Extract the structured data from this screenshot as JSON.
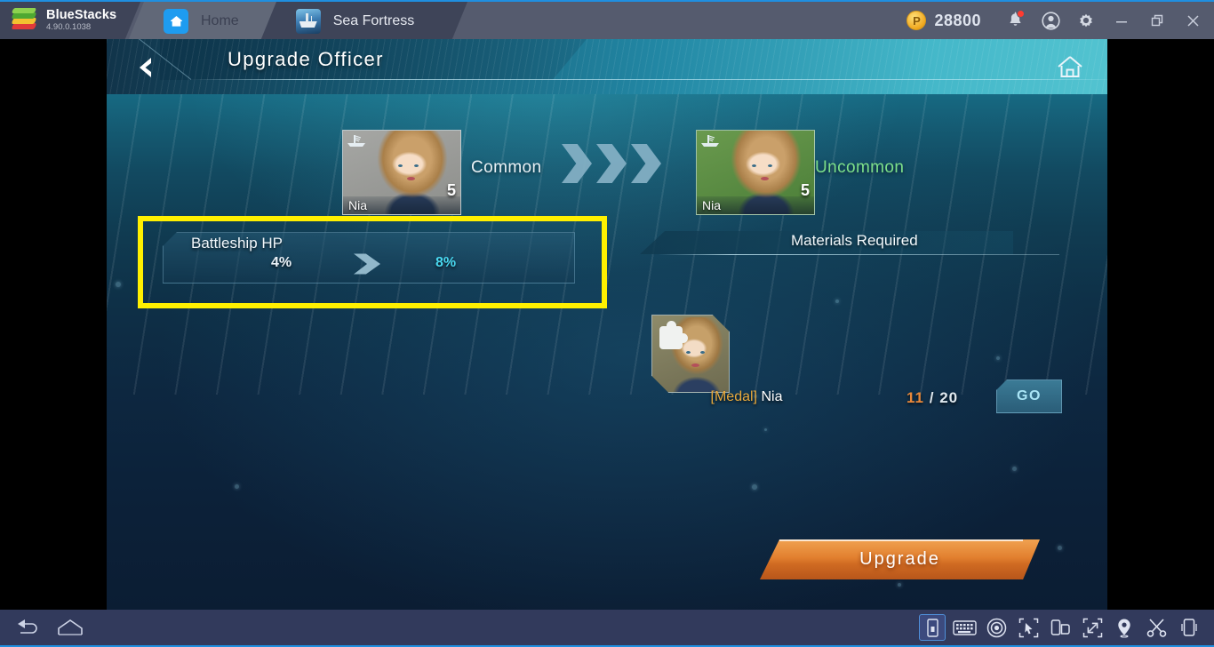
{
  "titlebar": {
    "brand_name": "BlueStacks",
    "version": "4.90.0.1038",
    "logo_icon": "bluestacks-logo",
    "tabs": [
      {
        "label": "Home",
        "icon": "home-app-icon",
        "active": false
      },
      {
        "label": "Sea Fortress",
        "icon": "sea-fortress-app-icon",
        "active": true
      }
    ],
    "points_icon": "points-coin-icon",
    "points_value": "28800",
    "notification_icon": "bell-icon",
    "account_icon": "account-avatar-icon",
    "settings_icon": "gear-icon",
    "minimize_icon": "minimize-icon",
    "restore_icon": "restore-icon",
    "close_icon": "close-icon"
  },
  "game": {
    "header": {
      "back_icon": "back-chevron-icon",
      "title": "Upgrade Officer",
      "home_icon": "home-icon"
    },
    "officers": {
      "before": {
        "name": "Nia",
        "level": "5",
        "rarity": "Common",
        "ship_icon": "battleship-icon"
      },
      "after": {
        "name": "Nia",
        "level": "5",
        "rarity": "Uncommon",
        "ship_icon": "battleship-icon"
      },
      "transition_icon": "double-chevron-right-icon"
    },
    "stat": {
      "name": "Battleship HP",
      "current_value": "4%",
      "next_value": "8%",
      "arrow_icon": "chevron-right-icon",
      "highlight_color": "#fff000"
    },
    "materials": {
      "section_title": "Materials Required",
      "item": {
        "bracket": "[Medal]",
        "name": "Nia",
        "icon": "medal-nia-icon",
        "owned": "11",
        "separator": "/",
        "required": "20",
        "go_label": "GO"
      }
    },
    "upgrade_button": "Upgrade"
  },
  "bottombar": {
    "left": [
      {
        "icon": "back-arrow-icon",
        "name": "android-back-button"
      },
      {
        "icon": "home-pentagon-icon",
        "name": "android-home-button"
      }
    ],
    "right": [
      {
        "icon": "install-apk-icon",
        "name": "install-apk-button",
        "selected": true
      },
      {
        "icon": "keyboard-icon",
        "name": "keyboard-controls-button",
        "selected": false
      },
      {
        "icon": "eye-macro-icon",
        "name": "macro-recorder-button",
        "selected": false
      },
      {
        "icon": "tap-cursor-icon",
        "name": "multi-instance-sync-button",
        "selected": false
      },
      {
        "icon": "rotate-screen-icon",
        "name": "rotate-screen-button",
        "selected": false
      },
      {
        "icon": "fullscreen-icon",
        "name": "fullscreen-button",
        "selected": false
      },
      {
        "icon": "location-pin-icon",
        "name": "location-button",
        "selected": false
      },
      {
        "icon": "scissors-icon",
        "name": "screenshot-button",
        "selected": false
      },
      {
        "icon": "shake-device-icon",
        "name": "shake-device-button",
        "selected": false
      }
    ]
  }
}
